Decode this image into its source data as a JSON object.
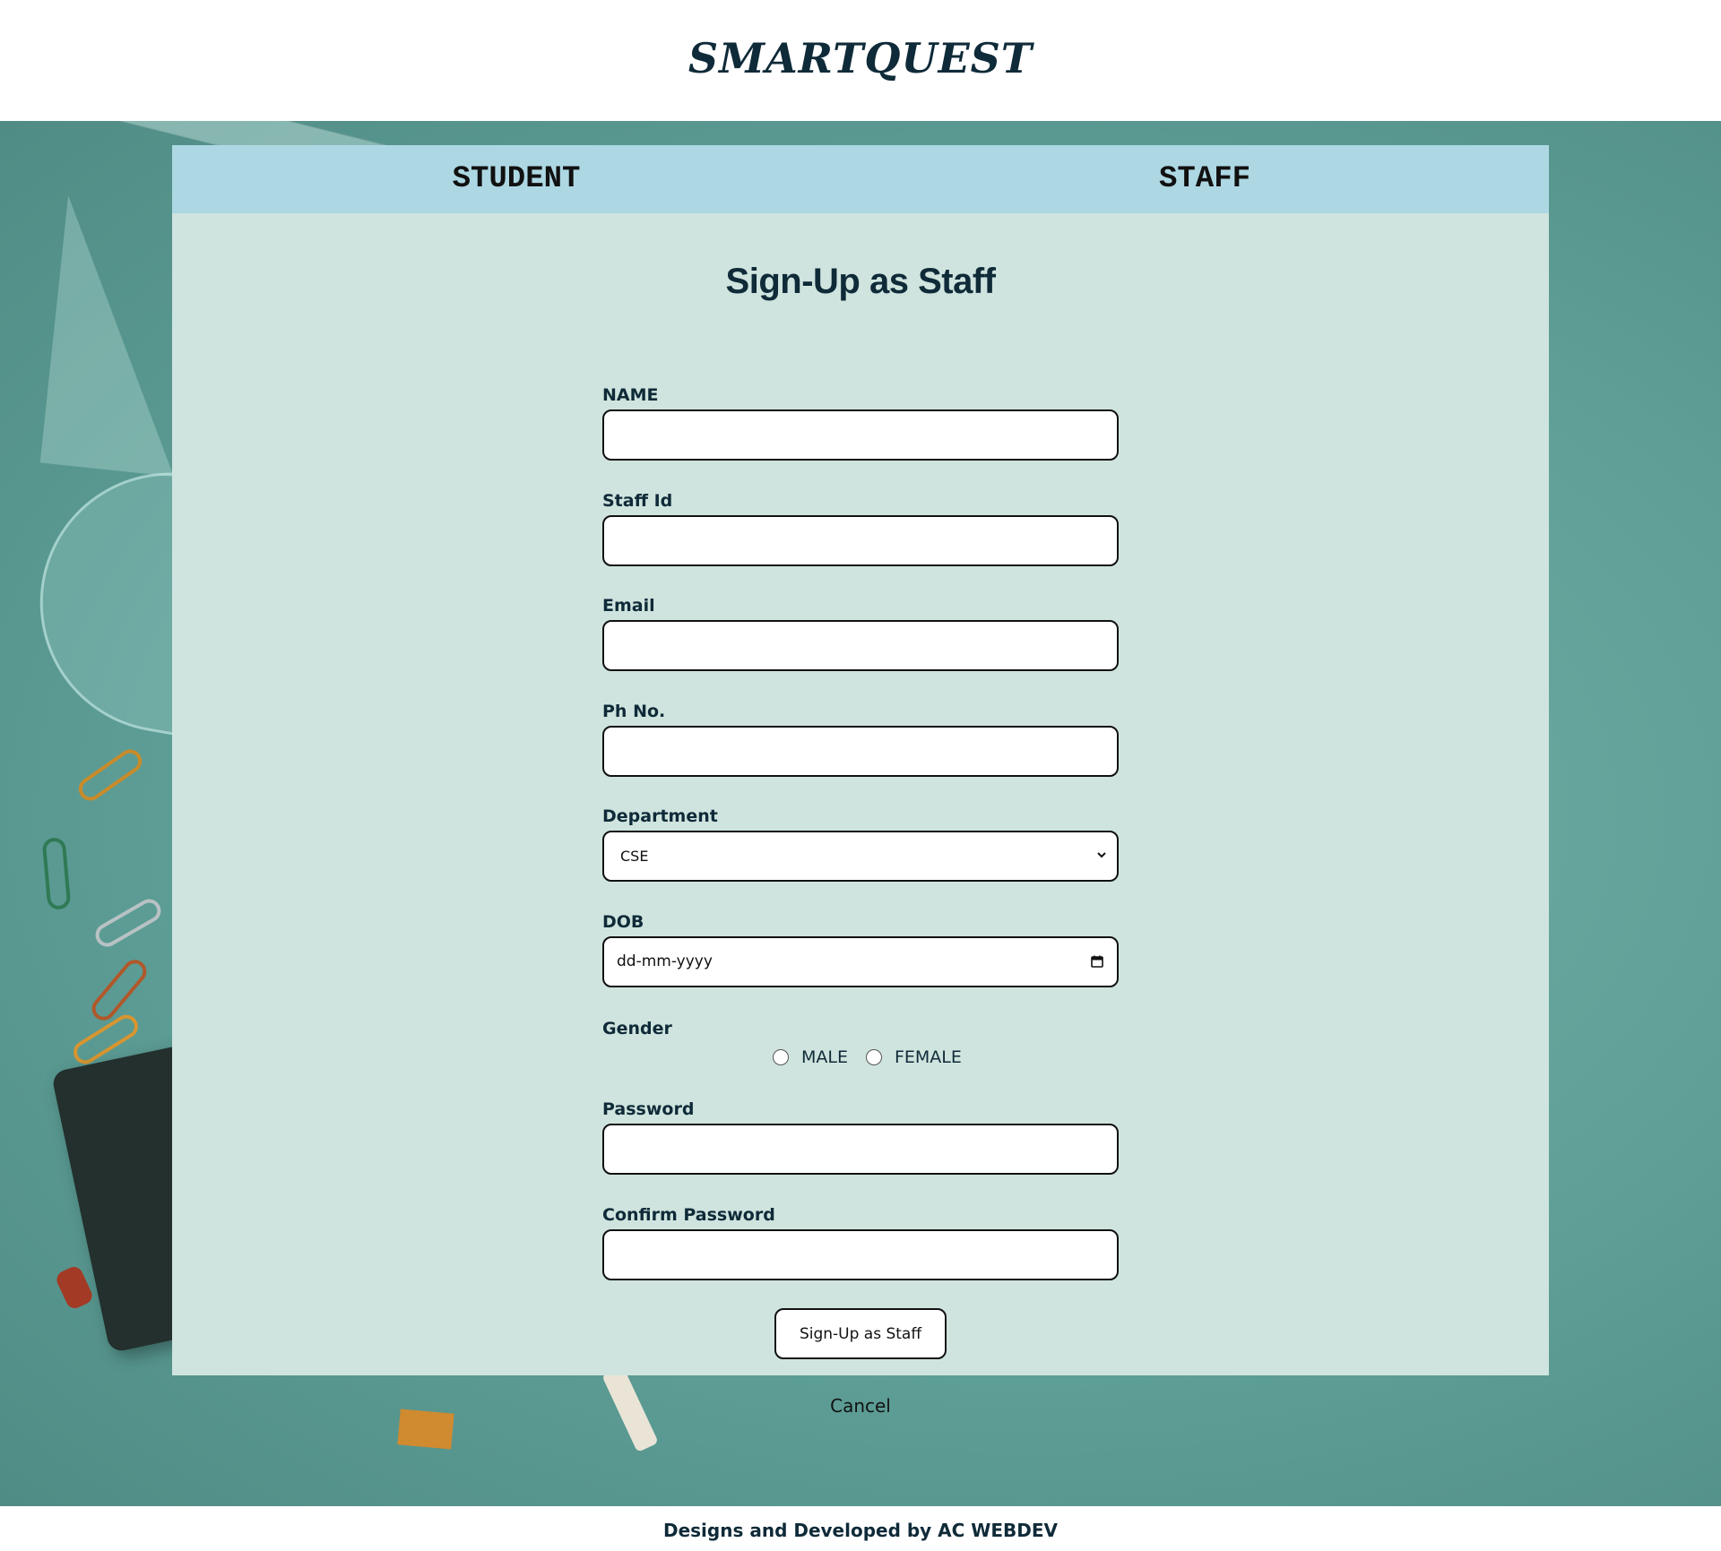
{
  "brand": {
    "name": "SMARTQUEST"
  },
  "tabs": [
    {
      "label": "STUDENT"
    },
    {
      "label": "STAFF"
    }
  ],
  "form": {
    "title": "Sign-Up as Staff",
    "fields": {
      "name": {
        "label": "NAME",
        "value": ""
      },
      "staff_id": {
        "label": "Staff Id",
        "value": ""
      },
      "email": {
        "label": "Email",
        "value": ""
      },
      "phone": {
        "label": "Ph No.",
        "value": ""
      },
      "department": {
        "label": "Department",
        "selected": "CSE"
      },
      "dob": {
        "label": "DOB",
        "placeholder": "dd-mm-yyyy"
      },
      "gender": {
        "label": "Gender",
        "options": [
          "MALE",
          "FEMALE"
        ]
      },
      "password": {
        "label": "Password",
        "value": ""
      },
      "confirm_password": {
        "label": "Confirm Password",
        "value": ""
      }
    },
    "submit_label": "Sign-Up as Staff",
    "cancel_label": "Cancel"
  },
  "footer": {
    "text": "Designs and Developed by AC WEBDEV"
  },
  "colors": {
    "brand_text": "#0f2a38",
    "tab_bar": "#add8e3",
    "panel_bg": "#cfe4de",
    "page_bg": "#5e9f97"
  }
}
